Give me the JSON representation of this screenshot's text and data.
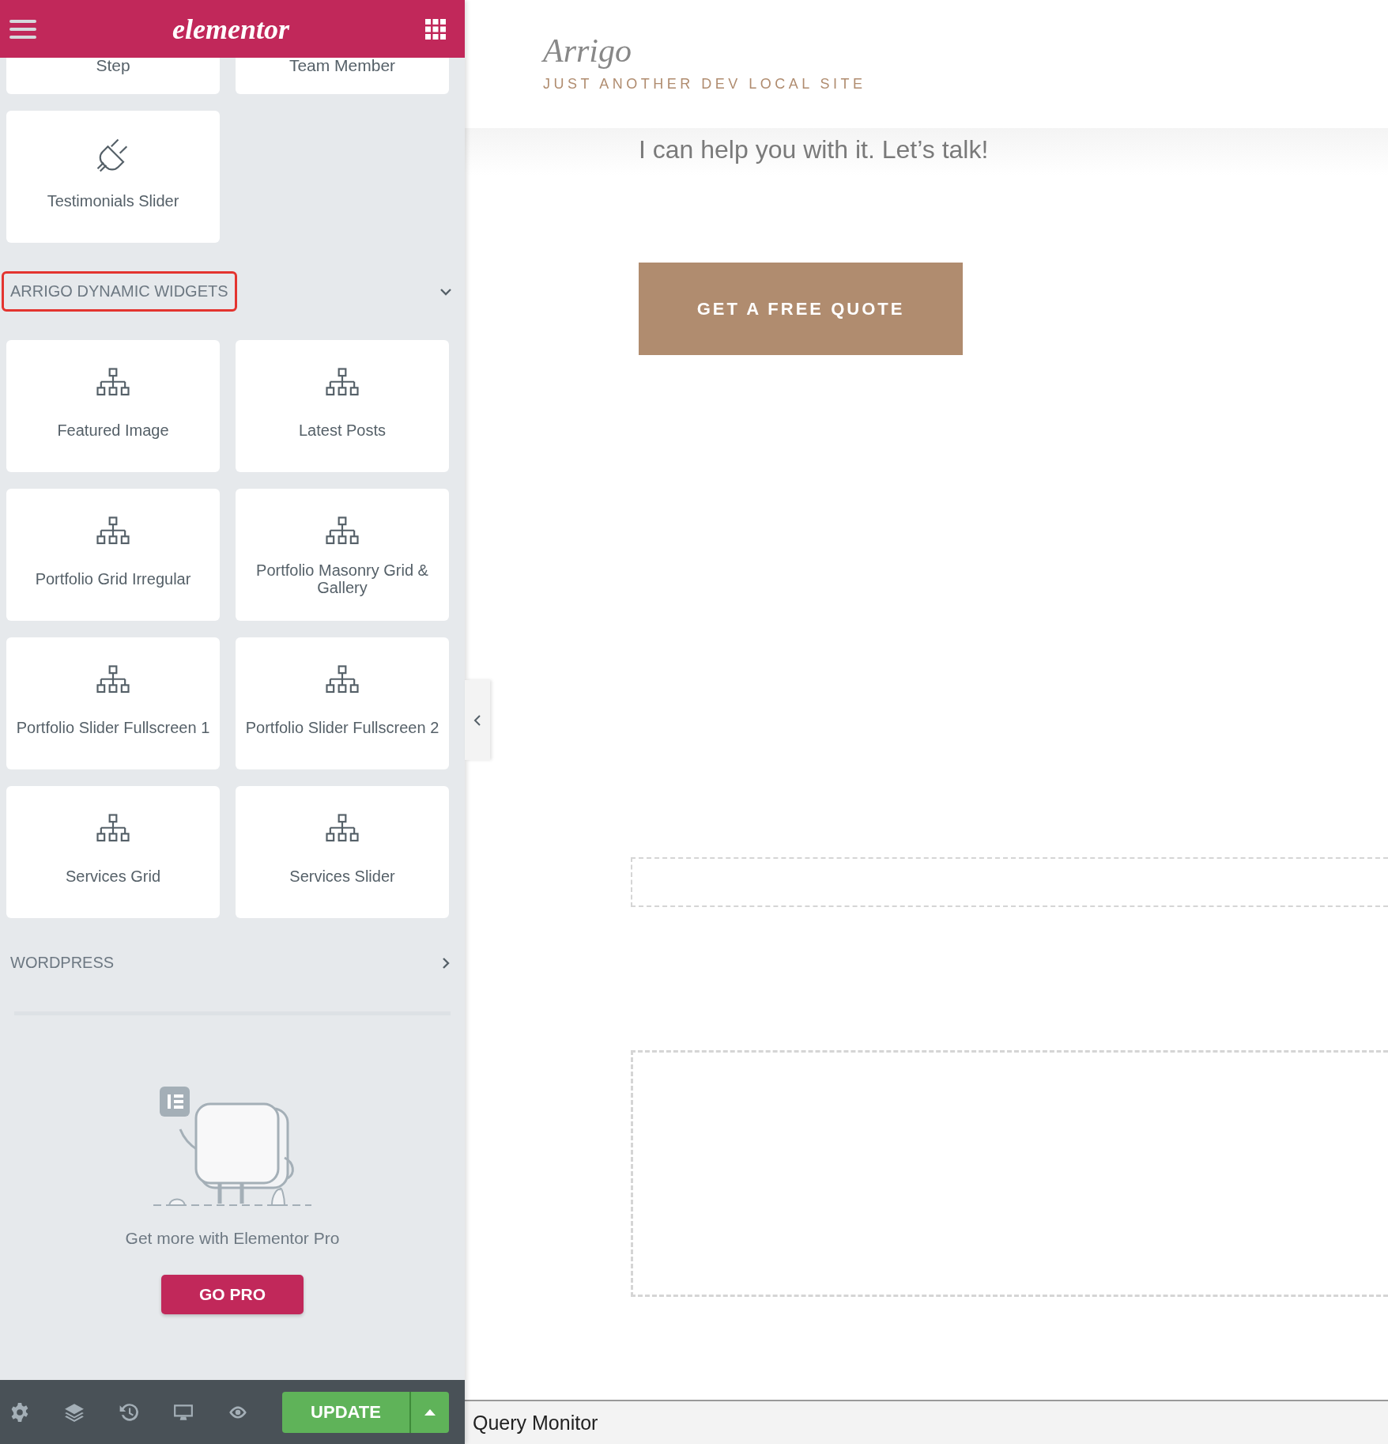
{
  "header": {
    "logo": "elementor"
  },
  "top_widgets": [
    {
      "label": "Step"
    },
    {
      "label": "Team Member"
    }
  ],
  "widgets": [
    {
      "label": "Testimonials Slider",
      "kind": "plug"
    }
  ],
  "sections": [
    {
      "title": "ARRIGO DYNAMIC WIDGETS",
      "expanded": true,
      "highlighted": true,
      "widgets": [
        {
          "label": "Featured Image",
          "kind": "sitemap"
        },
        {
          "label": "Latest Posts",
          "kind": "sitemap"
        },
        {
          "label": "Portfolio Grid Irregular",
          "kind": "sitemap"
        },
        {
          "label": "Portfolio Masonry Grid & Gallery",
          "kind": "sitemap"
        },
        {
          "label": "Portfolio Slider Fullscreen 1",
          "kind": "sitemap"
        },
        {
          "label": "Portfolio Slider Fullscreen 2",
          "kind": "sitemap"
        },
        {
          "label": "Services Grid",
          "kind": "sitemap"
        },
        {
          "label": "Services Slider",
          "kind": "sitemap"
        }
      ]
    },
    {
      "title": "WORDPRESS",
      "expanded": false,
      "highlighted": false
    }
  ],
  "promo": {
    "text": "Get more with Elementor Pro",
    "button": "GO PRO"
  },
  "footer": {
    "button": "UPDATE"
  },
  "site": {
    "title": "Arrigo",
    "tagline": "JUST ANOTHER DEV LOCAL SITE",
    "text": "I can help you with it. Let’s talk!",
    "button": "GET A FREE QUOTE"
  },
  "query_monitor": "Query Monitor"
}
